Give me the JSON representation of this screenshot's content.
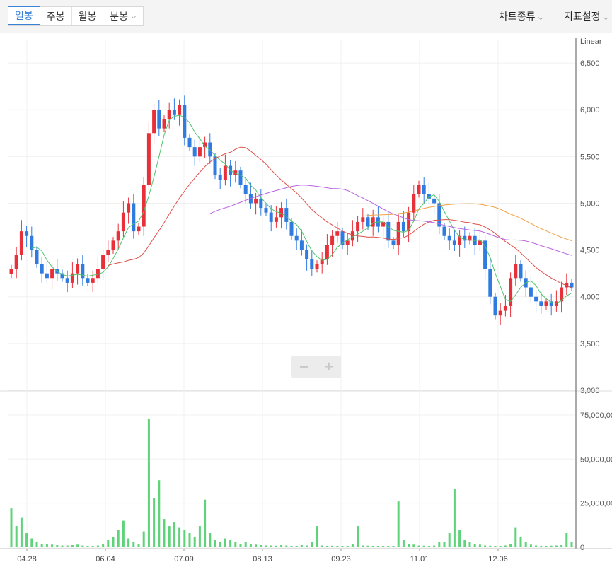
{
  "toolbar": {
    "periods": [
      {
        "label": "일봉",
        "active": true
      },
      {
        "label": "주봉",
        "active": false
      },
      {
        "label": "월봉",
        "active": false
      },
      {
        "label": "분봉",
        "active": false,
        "has_dropdown": true
      }
    ],
    "chart_type_label": "차트종류",
    "indicator_label": "지표설정",
    "dropdown_icon": "chevron-down-icon"
  },
  "zoom": {
    "minus": "−",
    "plus": "+"
  },
  "colors": {
    "up": "#e8303a",
    "down": "#2f7be0",
    "volume": "#5fd37a",
    "ma5": "#4cc46a",
    "ma20": "#e0504a",
    "ma60": "#b765e0",
    "ma120": "#f0a040",
    "grid": "#f0f0f0"
  },
  "chart_data": [
    {
      "type": "candlestick",
      "scale_label": "Linear",
      "ylim": [
        3000,
        6750
      ],
      "y_ticks": [
        "6,500",
        "6,000",
        "5,500",
        "5,000",
        "4,500",
        "4,000",
        "3,500",
        "3,000"
      ],
      "x_ticks": [
        "04.28",
        "06.04",
        "07.09",
        "08.13",
        "09.23",
        "11.01",
        "12.06"
      ],
      "close_series": [
        4300,
        4450,
        4700,
        4650,
        4500,
        4350,
        4250,
        4200,
        4300,
        4250,
        4200,
        4150,
        4250,
        4350,
        4200,
        4150,
        4200,
        4300,
        4450,
        4500,
        4600,
        4700,
        4900,
        5000,
        4700,
        4750,
        5200,
        5750,
        6000,
        5800,
        5900,
        6000,
        5950,
        6050,
        5700,
        5600,
        5500,
        5600,
        5650,
        5500,
        5300,
        5250,
        5400,
        5300,
        5350,
        5200,
        5100,
        5000,
        5050,
        4950,
        4900,
        4800,
        4850,
        4950,
        4800,
        4650,
        4600,
        4500,
        4400,
        4300,
        4350,
        4400,
        4550,
        4650,
        4700,
        4550,
        4600,
        4700,
        4800,
        4850,
        4750,
        4850,
        4750,
        4800,
        4600,
        4550,
        4800,
        4700,
        4900,
        5100,
        5200,
        5100,
        5050,
        5000,
        4750,
        4650,
        4600,
        4550,
        4650,
        4600,
        4650,
        4550,
        4600,
        4300,
        4000,
        3800,
        3850,
        3900,
        4200,
        4350,
        4200,
        4100,
        4000,
        3950,
        3900,
        3950,
        3900,
        3950,
        4100,
        4150,
        4100
      ],
      "volume": {
        "ylim": [
          0,
          85000000
        ],
        "y_ticks": [
          "75,000,000",
          "50,000,000",
          "25,000,000",
          "0"
        ],
        "values": [
          22000000,
          12000000,
          17000000,
          8000000,
          5000000,
          3000000,
          2000000,
          2000000,
          1500000,
          1200000,
          1000000,
          1000000,
          1200000,
          1500000,
          1000000,
          800000,
          800000,
          1000000,
          2000000,
          4000000,
          6000000,
          10000000,
          15000000,
          5000000,
          3000000,
          2000000,
          9000000,
          73000000,
          28000000,
          38000000,
          16000000,
          12000000,
          14000000,
          11000000,
          10000000,
          8000000,
          6000000,
          12000000,
          27000000,
          8000000,
          4000000,
          3000000,
          5000000,
          4000000,
          3000000,
          2000000,
          3000000,
          2000000,
          1500000,
          1200000,
          1000000,
          1000000,
          900000,
          1200000,
          1000000,
          800000,
          700000,
          1200000,
          1000000,
          3000000,
          12000000,
          1000000,
          800000,
          900000,
          700000,
          600000,
          800000,
          2000000,
          12000000,
          1000000,
          900000,
          800000,
          700000,
          600000,
          500000,
          800000,
          26000000,
          4000000,
          2000000,
          1500000,
          1000000,
          900000,
          800000,
          1000000,
          3000000,
          3000000,
          8000000,
          33000000,
          10000000,
          4000000,
          3000000,
          2000000,
          1500000,
          1000000,
          900000,
          800000,
          700000,
          1000000,
          2000000,
          11000000,
          6000000,
          3000000,
          1500000,
          1000000,
          800000,
          800000,
          900000,
          1000000,
          1200000,
          8000000,
          3000000
        ]
      }
    }
  ]
}
